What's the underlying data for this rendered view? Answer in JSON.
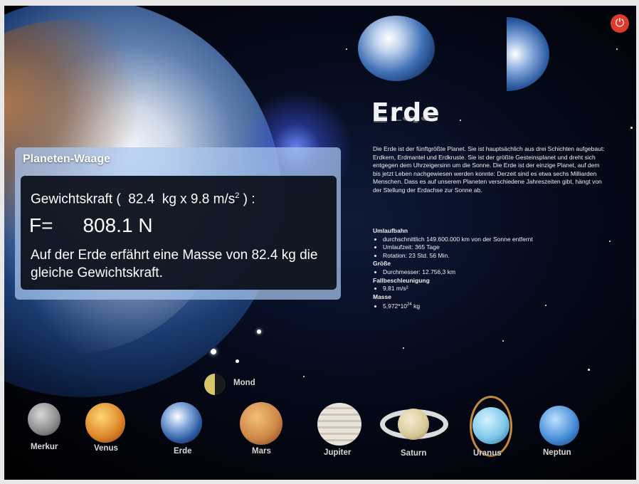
{
  "power_icon": "power-icon",
  "title": "Erde",
  "description": "Die Erde ist der fünftgrößte Planet. Sie ist hauptsächlich aus drei Schichten aufgebaut: Erdkern, Erdmantel und Erdkruste. Sie ist der größte Gesteinsplanet und dreht sich entgegen dem Uhrzeigersinn um die Sonne. Die Erde ist der einzige Planet, auf dem bis jetzt Leben nachgewiesen werden konnte: Derzeit sind es etwa sechs Milliarden Menschen. Dass es auf unserem Planeten verschiedene Jahreszeiten gibt, hängt von der Stellung der Erdachse zur Sonne ab.",
  "info": {
    "umlaufbahn_title": "Umlaufbahn",
    "umlaufbahn": [
      "durchschnittlich 149.600.000 km von der Sonne entfernt",
      "Umlaufzeit: 365 Tage",
      "Rotation: 23 Std. 56 Min."
    ],
    "groesse_title": "Größe",
    "groesse": [
      "Durchmesser: 12.756,3 km"
    ],
    "fall_title": "Fallbeschleunigung",
    "fall": [
      "9,81 m/s²"
    ],
    "masse_title": "Masse",
    "masse_base": "5,972*10",
    "masse_exp": "24",
    "masse_unit": " kg"
  },
  "panel": {
    "title": "Planeten-Waage",
    "formula_prefix": "Gewichtskraft (",
    "mass": "82.4",
    "formula_mid": "kg x 9.8 m/s",
    "formula_exp": "2",
    "formula_suffix": ") :",
    "result_label": "F=",
    "result_value": "808.1 N",
    "comment": "Auf der Erde erfährt eine Masse von 82.4 kg die gleiche Gewichtskraft."
  },
  "planets": {
    "mond": "Mond",
    "merkur": "Merkur",
    "venus": "Venus",
    "erde": "Erde",
    "mars": "Mars",
    "jupiter": "Jupiter",
    "saturn": "Saturn",
    "uranus": "Uranus",
    "neptun": "Neptun"
  },
  "colors": {
    "power": "#e03a2c",
    "panel": "#aac8f0",
    "text": "#f0f0f0"
  }
}
